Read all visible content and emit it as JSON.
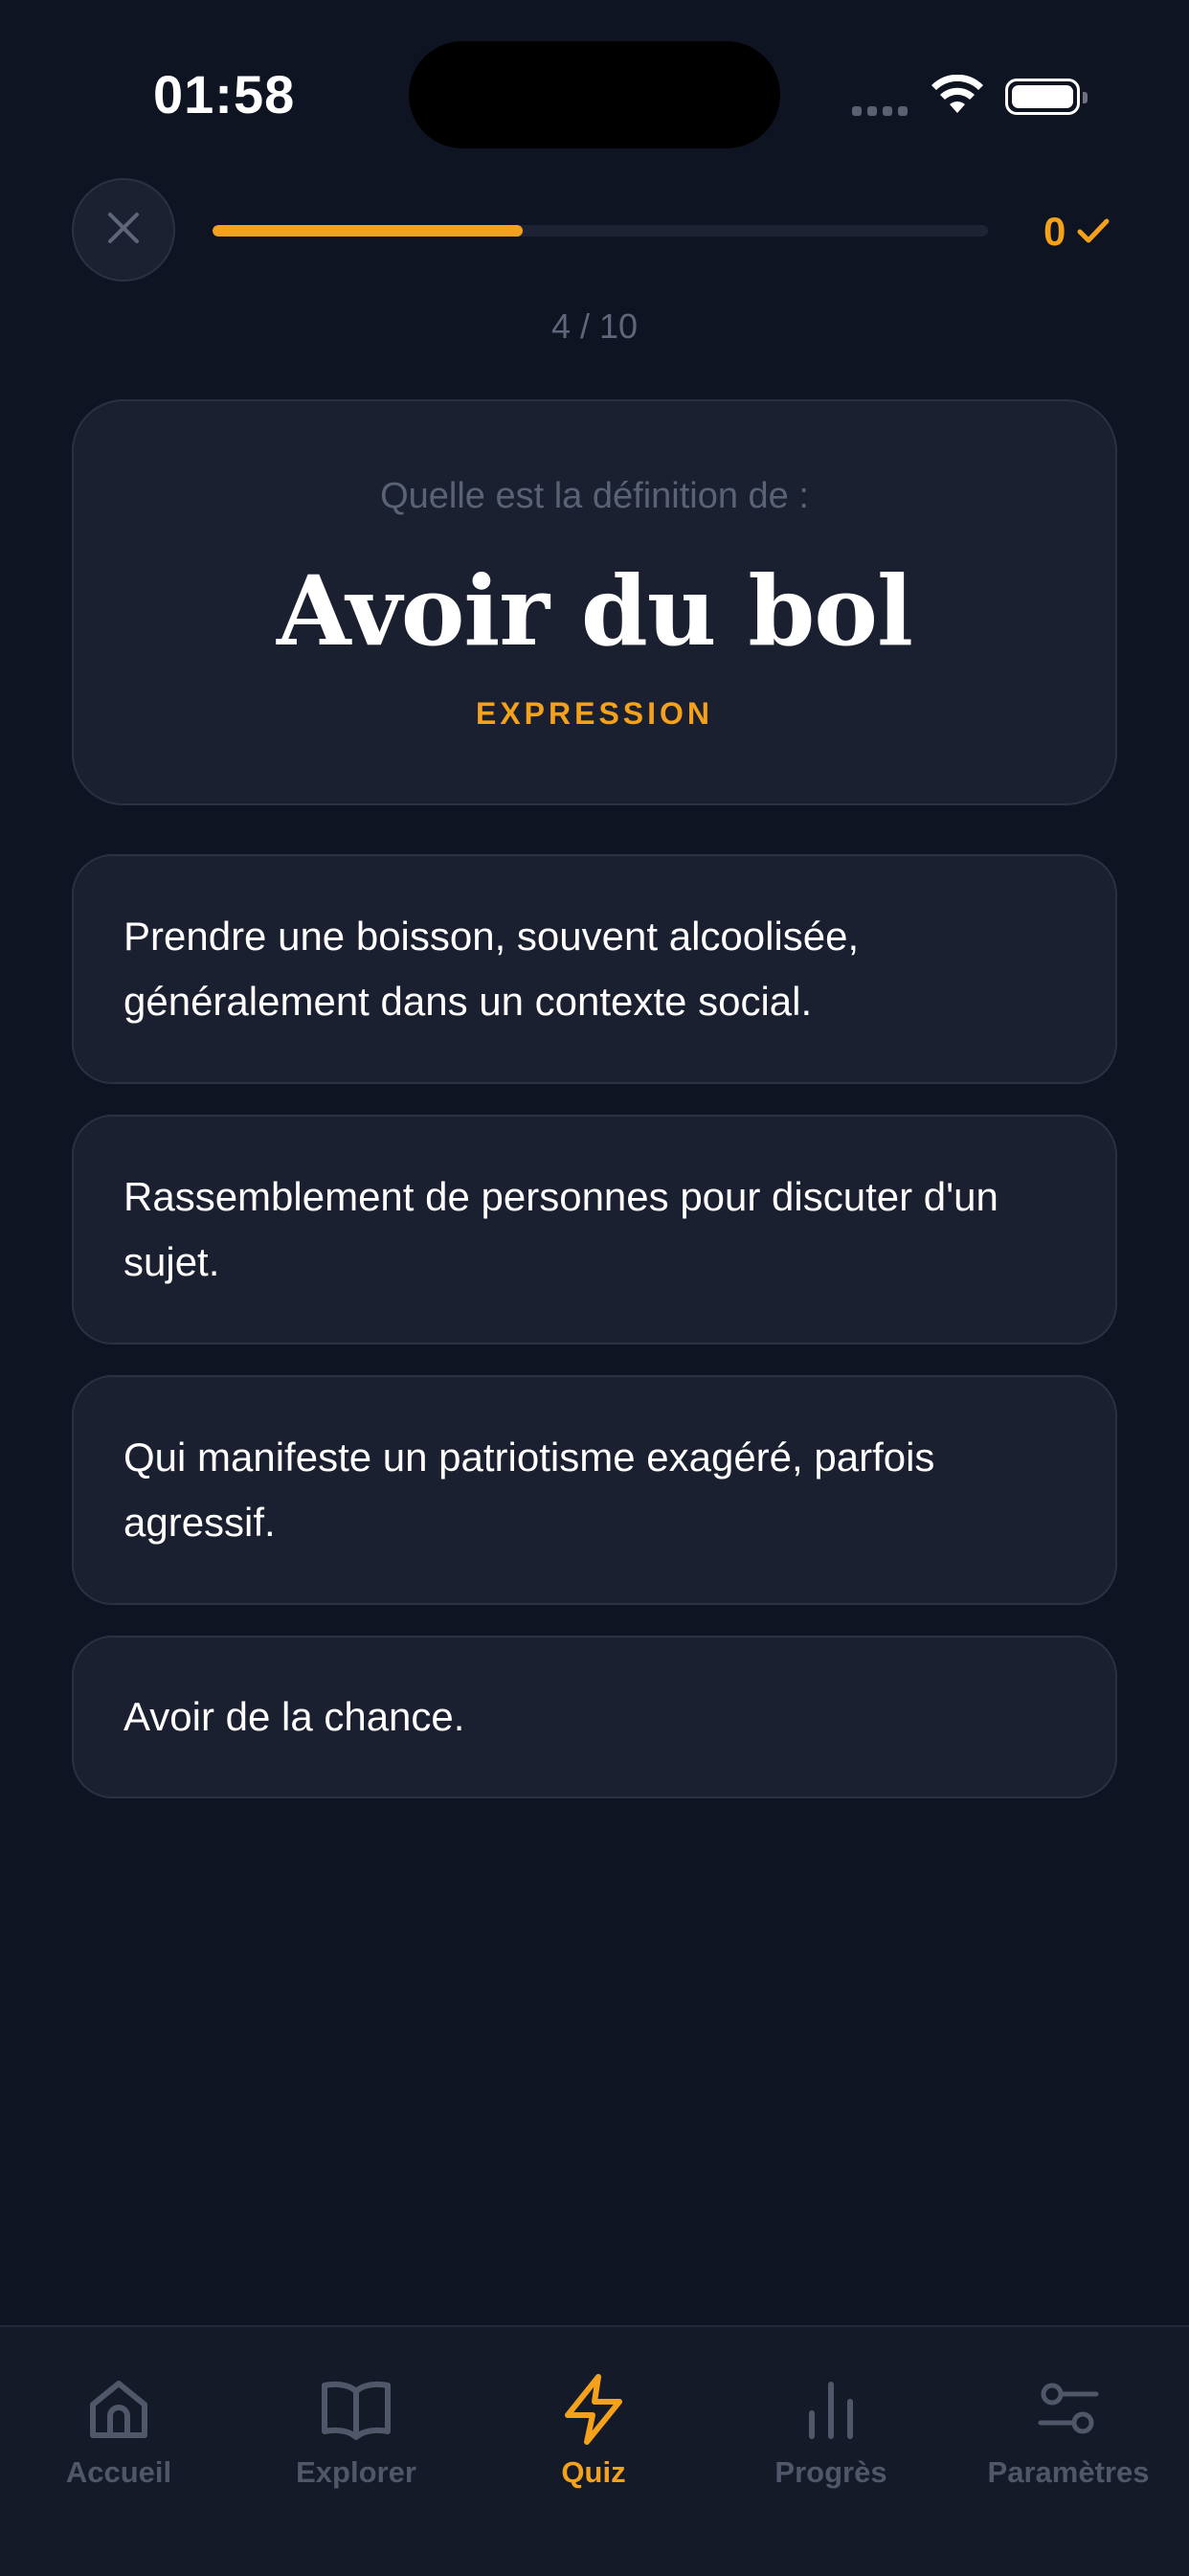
{
  "status_bar": {
    "time": "01:58"
  },
  "quiz_header": {
    "close_icon": "close-icon",
    "progress": 0.4,
    "score": "0",
    "score_icon": "check-icon",
    "counter": "4 / 10"
  },
  "question": {
    "prompt": "Quelle est la définition de :",
    "word": "Avoir du bol",
    "type": "EXPRESSION"
  },
  "answers": [
    {
      "text": "Prendre une boisson, souvent alcoolisée, généralement dans un contexte social."
    },
    {
      "text": "Rassemblement de personnes pour discuter d'un sujet."
    },
    {
      "text": "Qui manifeste un patriotisme exagéré, parfois agressif."
    },
    {
      "text": "Avoir de la chance."
    }
  ],
  "tab_bar": {
    "items": [
      {
        "label": "Accueil",
        "icon": "home-icon",
        "active": false
      },
      {
        "label": "Explorer",
        "icon": "book-icon",
        "active": false
      },
      {
        "label": "Quiz",
        "icon": "bolt-icon",
        "active": true
      },
      {
        "label": "Progrès",
        "icon": "bar-chart-icon",
        "active": false
      },
      {
        "label": "Paramètres",
        "icon": "sliders-icon",
        "active": false
      }
    ]
  },
  "colors": {
    "accent": "#f4a11c",
    "background": "#0f1422",
    "card": "#1b2030",
    "muted": "#4f5768"
  }
}
